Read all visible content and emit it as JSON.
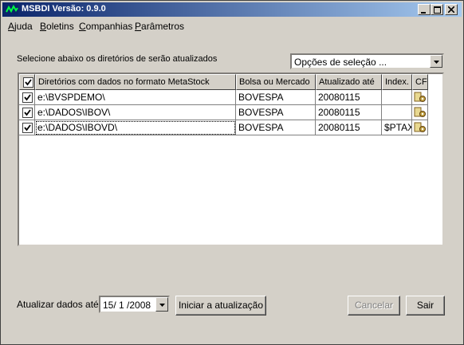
{
  "window": {
    "title": "MSBDI Versão: 0.9.0"
  },
  "menu": [
    {
      "accel": "A",
      "rest": "juda"
    },
    {
      "accel": "B",
      "rest": "oletins"
    },
    {
      "accel": "C",
      "rest": "ompanhias"
    },
    {
      "accel": "P",
      "rest": "arâmetros"
    }
  ],
  "selection": {
    "prompt": "Selecione abaixo os diretórios de serão atualizados",
    "options_value": "Opções de seleção ..."
  },
  "table": {
    "headers": [
      "Diretórios com dados no formato MetaStock",
      "Bolsa ou Mercado",
      "Atualizado até",
      "Index.",
      "CF"
    ],
    "rows": [
      {
        "checked": true,
        "dir": "e:\\BVSPDEMO\\",
        "bolsa": "BOVESPA",
        "ate": "20080115",
        "index": ""
      },
      {
        "checked": true,
        "dir": "e:\\DADOS\\IBOV\\",
        "bolsa": "BOVESPA",
        "ate": "20080115",
        "index": ""
      },
      {
        "checked": true,
        "dir": "e:\\DADOS\\IBOVD\\",
        "bolsa": "BOVESPA",
        "ate": "20080115",
        "index": "$PTAX"
      }
    ]
  },
  "footer": {
    "date_label": "Atualizar dados até:",
    "date_value": "15/ 1 /2008",
    "start_label": "Iniciar a atualização",
    "cancel_label": "Cancelar",
    "exit_label": "Sair"
  },
  "colors": {
    "titlebar_start": "#0a246a",
    "titlebar_end": "#a6caf0",
    "face": "#d4d0c8"
  },
  "icons": [
    "app-icon",
    "minimize-icon",
    "maximize-icon",
    "close-icon",
    "dropdown-arrow-icon",
    "checkbox-icon",
    "config-icon"
  ]
}
